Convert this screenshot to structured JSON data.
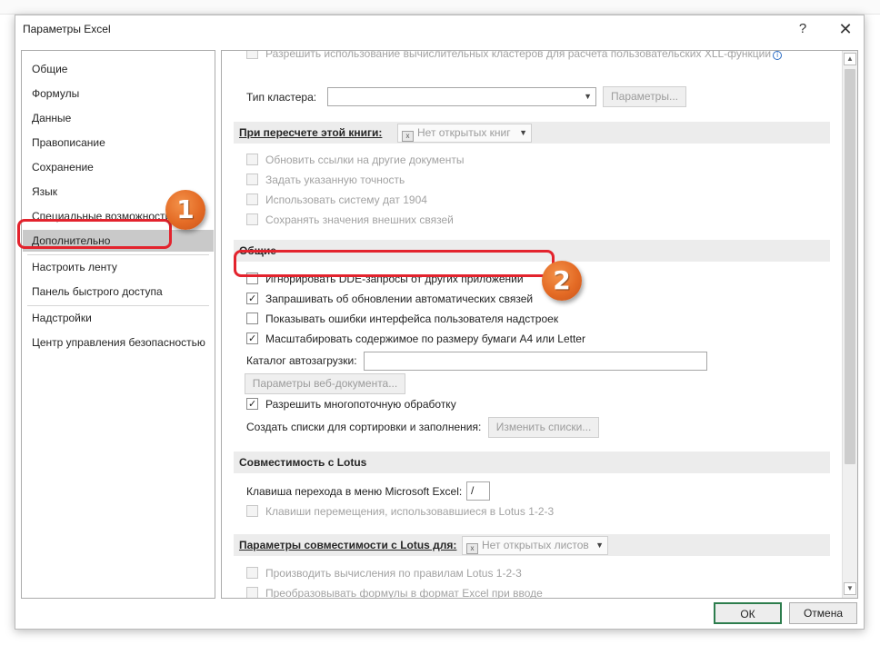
{
  "dialog": {
    "title": "Параметры Excel",
    "help_glyph": "?",
    "close_glyph": "✕"
  },
  "nav": {
    "items": [
      {
        "label": "Общие"
      },
      {
        "label": "Формулы"
      },
      {
        "label": "Данные"
      },
      {
        "label": "Правописание"
      },
      {
        "label": "Сохранение"
      },
      {
        "label": "Язык"
      },
      {
        "label": "Специальные возможности"
      },
      {
        "label": "Дополнительно",
        "selected": true
      },
      {
        "label": "Настроить ленту"
      },
      {
        "label": "Панель быстрого доступа"
      },
      {
        "label": "Надстройки"
      },
      {
        "label": "Центр управления безопасностью"
      }
    ]
  },
  "content": {
    "xll_row": {
      "label": "Разрешить использование вычислительных кластеров для расчета пользовательских XLL-функций",
      "checked": false,
      "info_glyph": "i"
    },
    "cluster_type": {
      "label": "Тип кластера:",
      "value": "",
      "button": "Параметры..."
    },
    "recalc_header": {
      "label": "При пересчете этой книги:",
      "combo_value": "Нет открытых книг"
    },
    "recalc_options": [
      {
        "label": "Обновить ссылки на другие документы",
        "checked": false
      },
      {
        "label": "Задать указанную точность",
        "checked": false
      },
      {
        "label": "Использовать систему дат 1904",
        "checked": false
      },
      {
        "label": "Сохранять значения внешних связей",
        "checked": false
      }
    ],
    "general_header": "Общие",
    "general_options": [
      {
        "label": "Игнорировать DDE-запросы от других приложений",
        "checked": false
      },
      {
        "label": "Запрашивать об обновлении автоматических связей",
        "checked": true
      },
      {
        "label": "Показывать ошибки интерфейса пользователя надстроек",
        "checked": false
      },
      {
        "label": "Масштабировать содержимое по размеру бумаги А4 или Letter",
        "checked": true
      }
    ],
    "autoload": {
      "label": "Каталог автозагрузки:",
      "value": ""
    },
    "web_options_button": "Параметры веб-документа...",
    "multithread": {
      "label": "Разрешить многопоточную обработку",
      "checked": true
    },
    "sort_lists": {
      "label": "Создать списки для сортировки и заполнения:",
      "button": "Изменить списки..."
    },
    "lotus_header": "Совместимость с Lotus",
    "menu_key": {
      "label": "Клавиша перехода в меню Microsoft Excel:",
      "value": "/"
    },
    "lotus_nav": {
      "label": "Клавиши перемещения, использовавшиеся в Lotus 1-2-3",
      "checked": false
    },
    "lotus_compat_header": {
      "label": "Параметры совместимости с Lotus для:",
      "combo_value": "Нет открытых листов"
    },
    "lotus_compat_options": [
      {
        "label": "Производить вычисления по правилам Lotus 1-2-3",
        "checked": false
      },
      {
        "label": "Преобразовывать формулы в формат Excel при вводе",
        "checked": false
      }
    ]
  },
  "footer": {
    "ok": "ОК",
    "cancel": "Отмена"
  },
  "callouts": {
    "one": "1",
    "two": "2"
  },
  "colors": {
    "callout_red": "#e3232d",
    "badge_orange": "#e46b25",
    "ok_border": "#2d7d4d"
  }
}
